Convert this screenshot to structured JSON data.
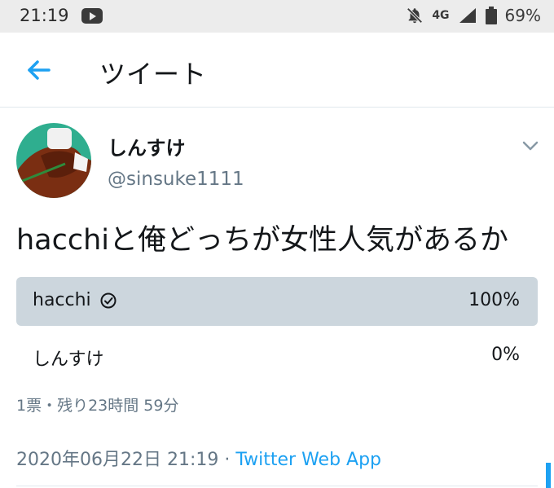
{
  "status_bar": {
    "time": "21:19",
    "network": "4G",
    "battery": "69%"
  },
  "header": {
    "title": "ツイート"
  },
  "tweet": {
    "display_name": "しんすけ",
    "handle": "@sinsuke1111",
    "text": "hacchiと俺どっちが女性人気があるか",
    "poll": {
      "options": [
        {
          "label": "hacchi",
          "percent_text": "100%",
          "fraction": 1.0,
          "winner": true
        },
        {
          "label": "しんすけ",
          "percent_text": "0%",
          "fraction": 0.0,
          "winner": false
        }
      ],
      "meta": "1票・残り23時間 59分"
    },
    "timestamp": "2020年06月22日 21:19",
    "separator": " · ",
    "source": "Twitter Web App"
  },
  "colors": {
    "accent": "#1da1f2",
    "poll_fill": "#ccd6dd",
    "secondary_text": "#657786"
  },
  "icons": [
    "back-arrow-icon",
    "chevron-down-icon",
    "check-circle-icon",
    "youtube-icon",
    "notifications-off-icon",
    "signal-icon",
    "battery-icon"
  ]
}
